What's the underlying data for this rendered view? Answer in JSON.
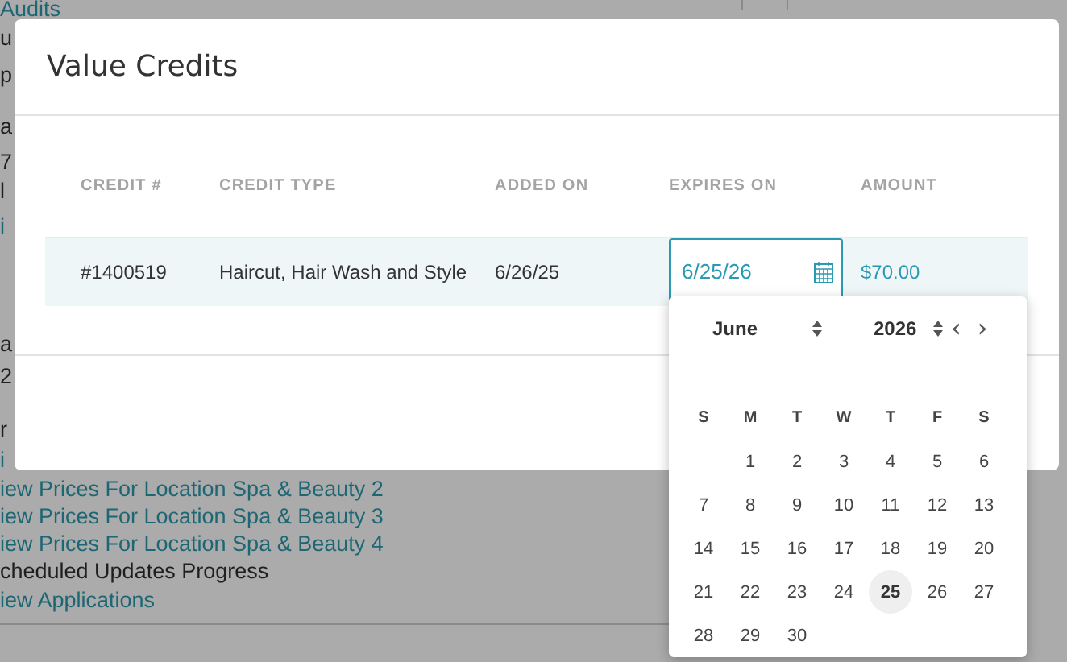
{
  "background_page": {
    "lines": [
      {
        "text": "Audits",
        "kind": "link"
      },
      {
        "text": "u",
        "kind": "text"
      },
      {
        "text": "p",
        "kind": "text"
      },
      {
        "text": "a",
        "kind": "text"
      },
      {
        "text": "7",
        "kind": "text"
      },
      {
        "text": "l",
        "kind": "text"
      },
      {
        "text": "i",
        "kind": "link"
      },
      {
        "text": "a",
        "kind": "text"
      },
      {
        "text": "2",
        "kind": "text"
      },
      {
        "text": "r",
        "kind": "text"
      },
      {
        "text": "i",
        "kind": "link"
      },
      {
        "text": "iew Prices For Location Spa & Beauty 2",
        "kind": "link"
      },
      {
        "text": "iew Prices For Location Spa & Beauty 3",
        "kind": "link"
      },
      {
        "text": "iew Prices For Location Spa & Beauty 4",
        "kind": "link"
      },
      {
        "text": "cheduled Updates Progress",
        "kind": "text"
      },
      {
        "text": "iew Applications",
        "kind": "link"
      }
    ]
  },
  "modal": {
    "title": "Value Credits",
    "table": {
      "columns": [
        "CREDIT #",
        "CREDIT TYPE",
        "ADDED ON",
        "EXPIRES ON",
        "AMOUNT"
      ],
      "rows": [
        {
          "credit": "#1400519",
          "type": "Haircut, Hair Wash and Style",
          "added_on": "6/26/25",
          "expires_on": "6/25/26",
          "amount": "$70.00"
        }
      ]
    }
  },
  "date_picker": {
    "month": "June",
    "year": "2026",
    "prev": "‹",
    "next": "›",
    "weekdays": [
      "S",
      "M",
      "T",
      "W",
      "T",
      "F",
      "S"
    ],
    "weeks": [
      [
        {
          "day": "1",
          "selected": false
        },
        {
          "day": "2",
          "selected": false
        },
        {
          "day": "3",
          "selected": false
        },
        {
          "day": "4",
          "selected": false
        },
        {
          "day": "5",
          "selected": false
        },
        {
          "day": "6",
          "selected": false
        }
      ],
      [
        {
          "day": "7",
          "selected": false
        },
        {
          "day": "8",
          "selected": false
        },
        {
          "day": "9",
          "selected": false
        },
        {
          "day": "10",
          "selected": false
        },
        {
          "day": "11",
          "selected": false
        },
        {
          "day": "12",
          "selected": false
        },
        {
          "day": "13",
          "selected": false
        }
      ],
      [
        {
          "day": "14",
          "selected": false
        },
        {
          "day": "15",
          "selected": false
        },
        {
          "day": "16",
          "selected": false
        },
        {
          "day": "17",
          "selected": false
        },
        {
          "day": "18",
          "selected": false
        },
        {
          "day": "19",
          "selected": false
        },
        {
          "day": "20",
          "selected": false
        }
      ],
      [
        {
          "day": "21",
          "selected": false
        },
        {
          "day": "22",
          "selected": false
        },
        {
          "day": "23",
          "selected": false
        },
        {
          "day": "24",
          "selected": false
        },
        {
          "day": "25",
          "selected": true
        },
        {
          "day": "26",
          "selected": false
        },
        {
          "day": "27",
          "selected": false
        }
      ],
      [
        {
          "day": "28",
          "selected": false
        },
        {
          "day": "29",
          "selected": false
        },
        {
          "day": "30",
          "selected": false
        }
      ]
    ]
  }
}
